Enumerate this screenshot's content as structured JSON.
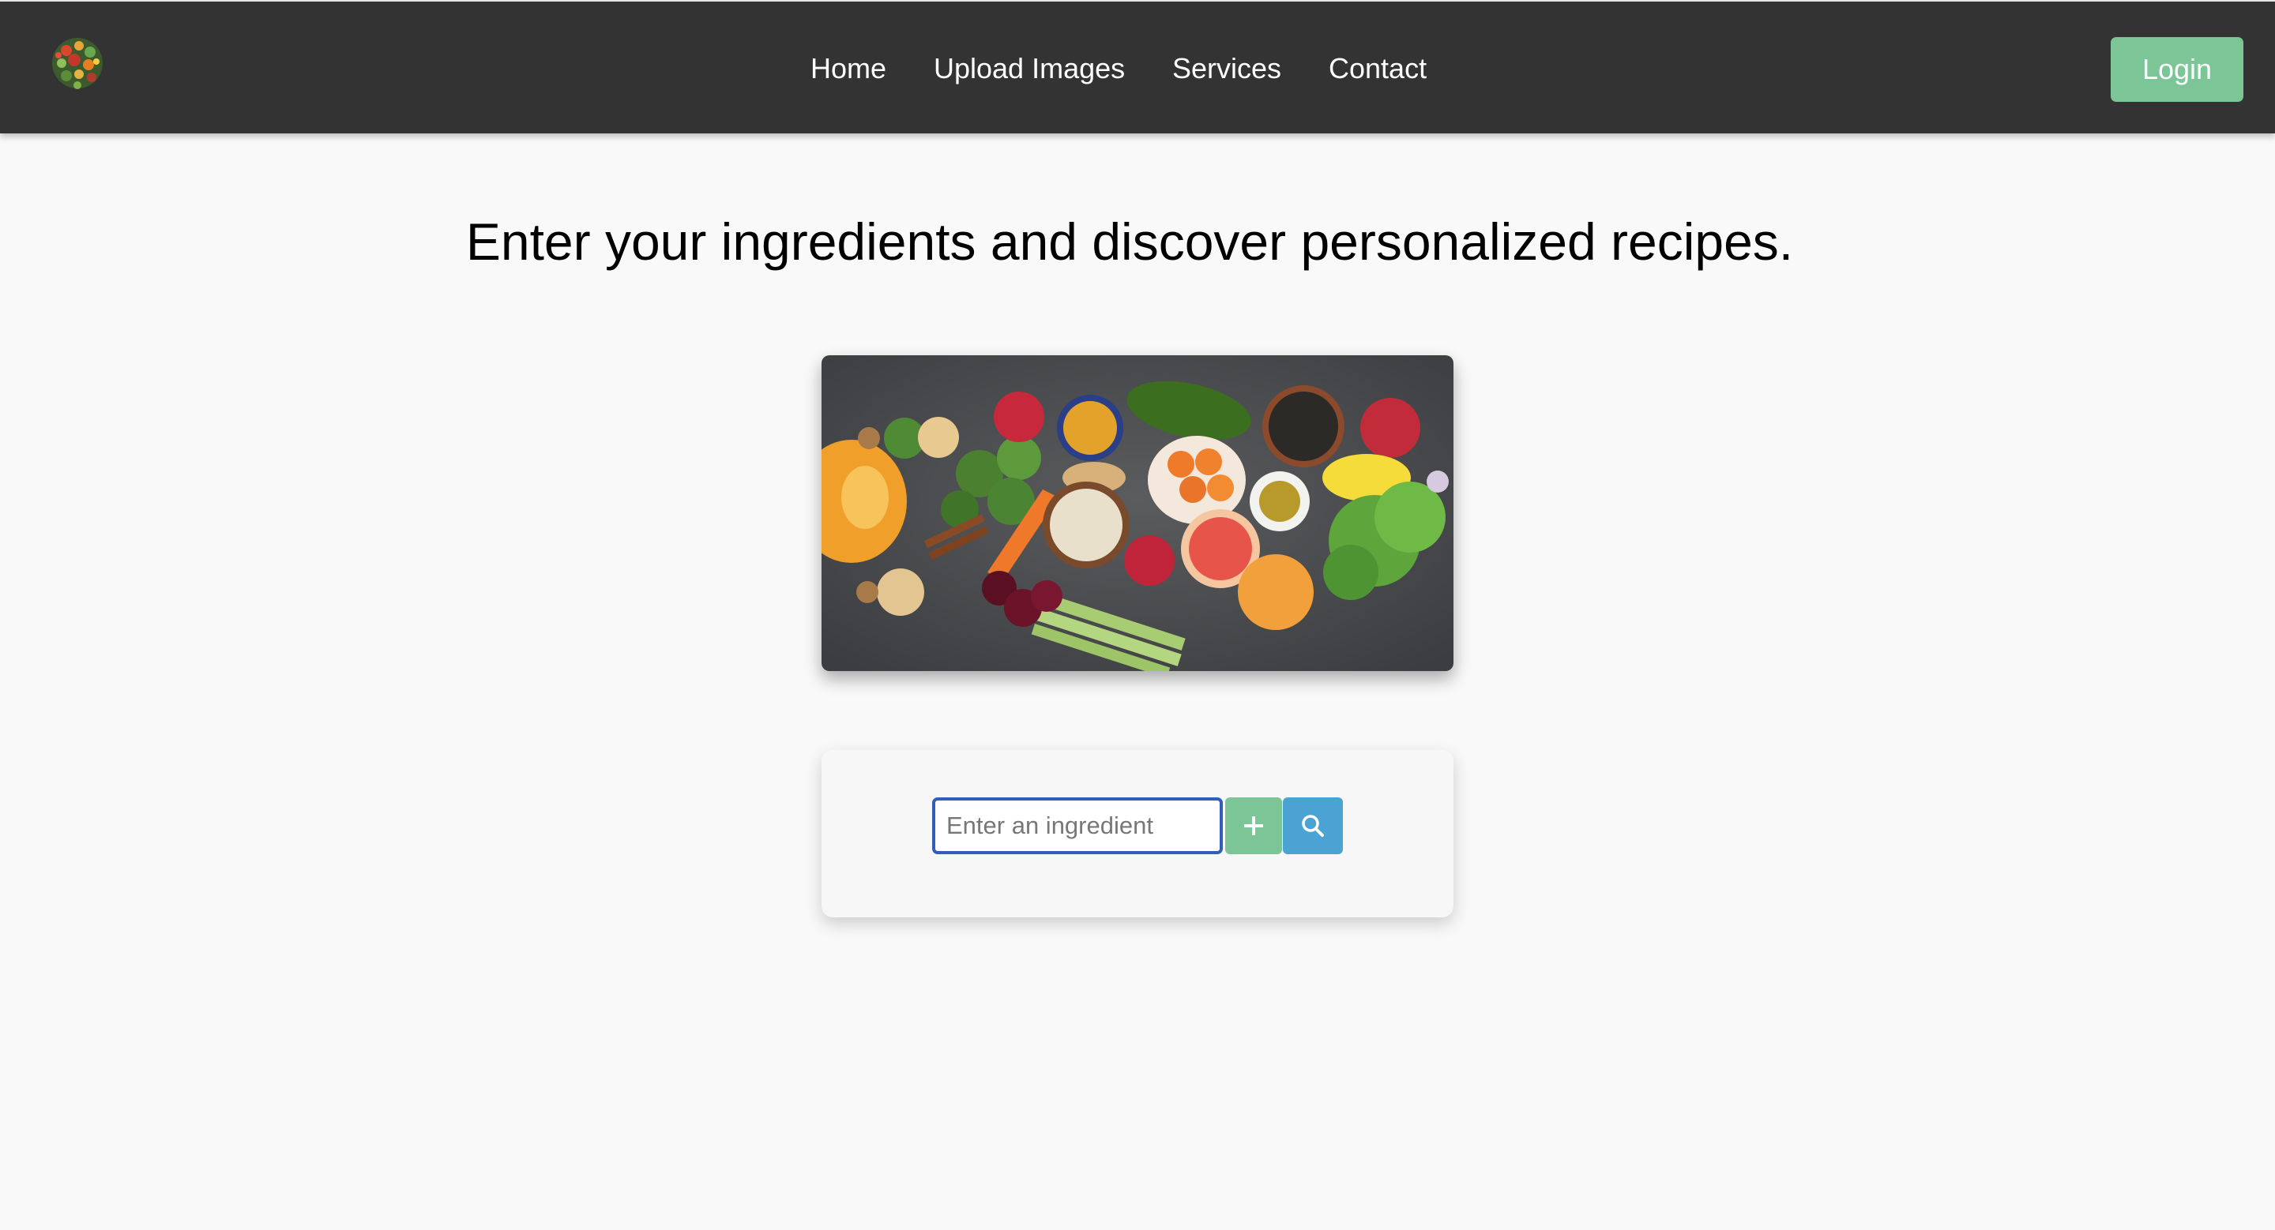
{
  "nav": {
    "logo_icon": "vegetable-bouquet-logo-icon",
    "links": [
      "Home",
      "Upload Images",
      "Services",
      "Contact"
    ],
    "login_label": "Login"
  },
  "main": {
    "headline": "Enter your ingredients and discover personalized recipes.",
    "hero_image": "assorted-fruits-vegetables-photo"
  },
  "search": {
    "placeholder": "Enter an ingredient",
    "value": "",
    "add_icon": "plus-icon",
    "search_icon": "search-icon"
  },
  "colors": {
    "navbar": "#333333",
    "accent_green": "#7bc596",
    "accent_blue": "#4aa3d3",
    "input_border": "#2f5fb8",
    "background": "#f9f9f9"
  }
}
